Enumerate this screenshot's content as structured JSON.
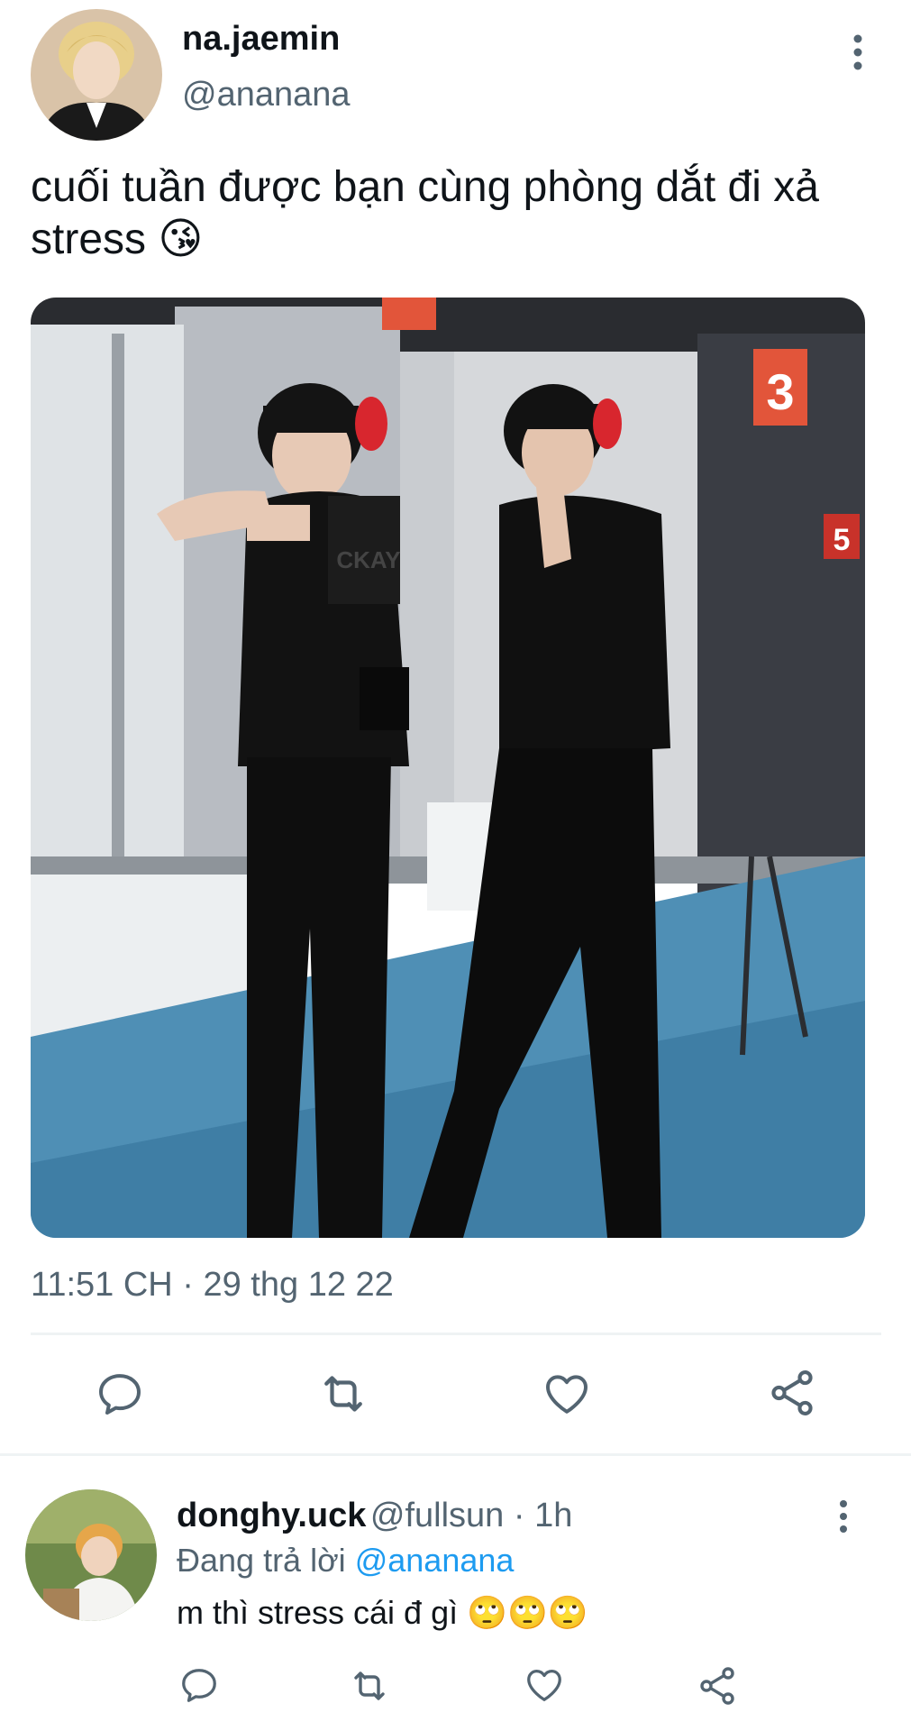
{
  "tweet": {
    "display_name": "na.jaemin",
    "handle": "@ananana",
    "text_line1": "cuối tuần được bạn cùng phòng dắt đi xả",
    "text_line2": "stress",
    "text_emoji": "😘",
    "timestamp": "11:51 CH · 29 thg 12 22",
    "photo_signs": {
      "sign3": "3",
      "sign5": "5",
      "shirt": "CKAY"
    },
    "actions": {
      "reply_icon": "speech-bubble-icon",
      "retweet_icon": "retweet-icon",
      "like_icon": "heart-icon",
      "share_icon": "share-icon"
    }
  },
  "reply": {
    "display_name": "donghy.uck",
    "handle": "@fullsun · 1h",
    "replying_prefix": "Đang trả lời",
    "replying_to": "@ananana",
    "text": "m thì stress cái đ gì",
    "emojis": "🙄🙄🙄"
  },
  "colors": {
    "text": "#0f1419",
    "secondary": "#536471",
    "link": "#1d9bf0",
    "divider": "#eff3f4"
  }
}
